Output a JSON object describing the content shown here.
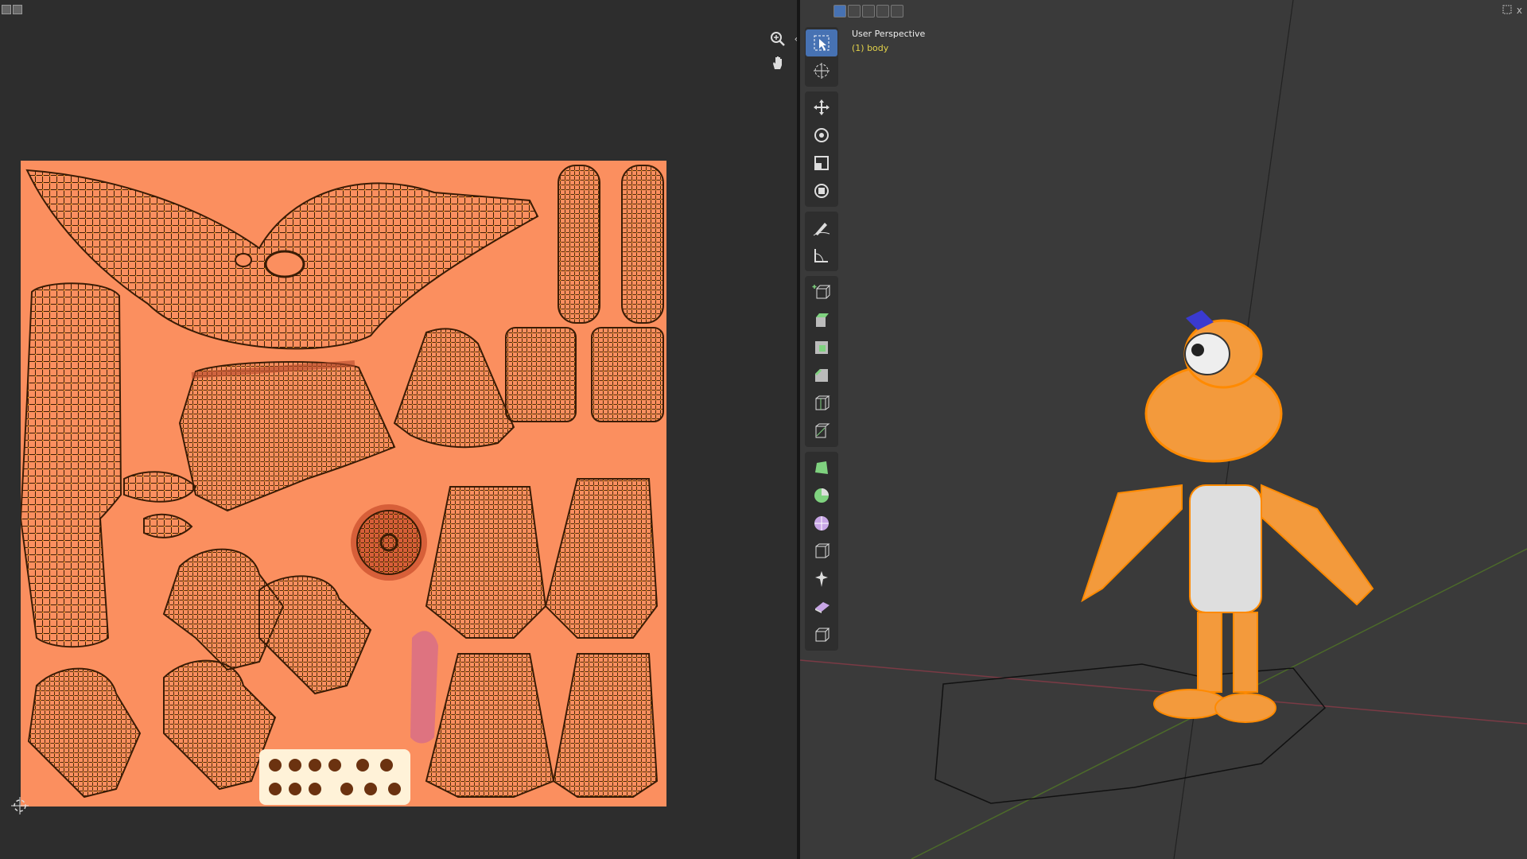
{
  "uv_editor": {
    "nav": {
      "zoom_icon": "zoom-icon",
      "pan_icon": "hand-pan-icon",
      "collapse_glyph": "‹"
    }
  },
  "viewport": {
    "view_name": "User Perspective",
    "active_object": "(1) body",
    "select_modes": [
      "box-select",
      "extend",
      "subtract",
      "invert",
      "intersect"
    ],
    "tools": [
      "select-box-icon",
      "cursor-icon",
      "move-icon",
      "rotate-icon",
      "scale-icon",
      "transform-icon",
      "annotate-icon",
      "measure-icon",
      "add-cube-icon",
      "extrude-icon",
      "inset-icon",
      "bevel-icon",
      "loop-cut-icon",
      "knife-icon",
      "poly-build-icon",
      "spin-icon",
      "smooth-icon",
      "edge-slide-icon",
      "shrink-icon",
      "shear-icon",
      "rip-icon"
    ],
    "close_glyph": "x"
  },
  "colors": {
    "uv_background": "#fb8f5f",
    "wire": "#3a1c05",
    "selected_vertex": "#ff9b1a",
    "active_tool": "#4772b3",
    "object_label": "#e2d24a"
  }
}
